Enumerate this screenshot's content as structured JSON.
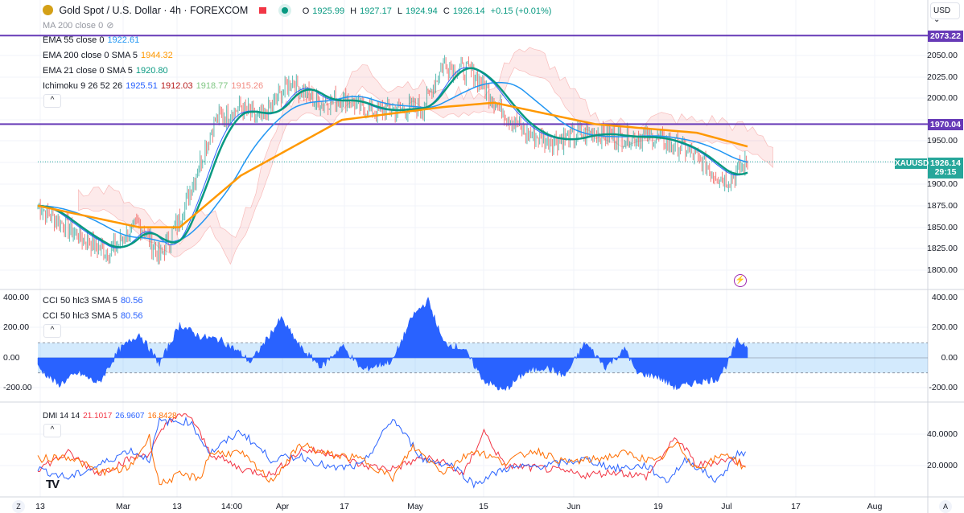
{
  "header": {
    "symbol": "Gold Spot / U.S. Dollar · 4h · FOREXCOM",
    "open_label": "O",
    "open": "1925.99",
    "high_label": "H",
    "high": "1927.17",
    "low_label": "L",
    "low": "1924.94",
    "close_label": "C",
    "close": "1926.14",
    "change": "+0.15 (+0.01%)"
  },
  "indicators": {
    "ma": "MA 200 close 0",
    "ema55": {
      "label": "EMA 55 close 0",
      "value": "1922.61"
    },
    "ema200": {
      "label": "EMA 200 close 0 SMA 5",
      "value": "1944.32"
    },
    "ema21": {
      "label": "EMA 21 close 0 SMA 5",
      "value": "1920.80"
    },
    "ichimoku": {
      "label": "Ichimoku 9 26 52 26",
      "v1": "1925.51",
      "v2": "1912.03",
      "v3": "1918.77",
      "v4": "1915.26"
    },
    "cci1": {
      "label": "CCI 50 hlc3 SMA 5",
      "value": "80.56"
    },
    "cci2": {
      "label": "CCI 50 hlc3 SMA 5",
      "value": "80.56"
    },
    "dmi": {
      "label": "DMI 14 14",
      "v1": "21.1017",
      "v2": "26.9607",
      "v3": "16.8428"
    }
  },
  "currency": "USD",
  "collapse_label": "^",
  "price_axis": [
    "2050.00",
    "2025.00",
    "2000.00",
    "1950.00",
    "1900.00",
    "1875.00",
    "1850.00",
    "1825.00",
    "1800.00"
  ],
  "hlines": {
    "upper": "2073.22",
    "lower": "1970.04"
  },
  "last_price": {
    "symbol": "XAUUSD",
    "price": "1926.14",
    "countdown": "29:15"
  },
  "cci_axis": [
    "400.00",
    "200.00",
    "0.00",
    "-200.00"
  ],
  "dmi_axis": [
    "40.0000",
    "20.0000"
  ],
  "time_axis": [
    "13",
    "Mar",
    "13",
    "14:00",
    "Apr",
    "17",
    "May",
    "15",
    "Jun",
    "19",
    "Jul",
    "17",
    "Aug"
  ],
  "corner": {
    "left": "Z",
    "right": "A"
  },
  "colors": {
    "up": "#26a69a",
    "down": "#ef5350",
    "ema55": "#2196f3",
    "ema200": "#ff9800",
    "ema21": "#089981",
    "hline": "#673ab7",
    "cci": "#2962ff",
    "dmi_plus": "#f23645",
    "dmi_minus": "#2962ff",
    "adx": "#ff6d00"
  },
  "chart_data": {
    "type": "line",
    "title": "Gold Spot / U.S. Dollar · 4h",
    "x_unit": "days since Feb 13",
    "close": [
      [
        0,
        1875
      ],
      [
        8,
        1840
      ],
      [
        14,
        1820
      ],
      [
        20,
        1855
      ],
      [
        24,
        1815
      ],
      [
        28,
        1860
      ],
      [
        31,
        1910
      ],
      [
        35,
        1975
      ],
      [
        40,
        1990
      ],
      [
        44,
        1975
      ],
      [
        50,
        2020
      ],
      [
        55,
        1995
      ],
      [
        60,
        2000
      ],
      [
        66,
        1985
      ],
      [
        76,
        1990
      ],
      [
        80,
        2040
      ],
      [
        86,
        2030
      ],
      [
        91,
        1990
      ],
      [
        96,
        1960
      ],
      [
        102,
        1950
      ],
      [
        109,
        1960
      ],
      [
        115,
        1955
      ],
      [
        121,
        1955
      ],
      [
        128,
        1940
      ],
      [
        133,
        1915
      ],
      [
        136,
        1905
      ],
      [
        140,
        1926
      ]
    ],
    "ema200": [
      [
        0,
        1875
      ],
      [
        20,
        1850
      ],
      [
        28,
        1850
      ],
      [
        40,
        1910
      ],
      [
        60,
        1975
      ],
      [
        80,
        1990
      ],
      [
        90,
        1995
      ],
      [
        110,
        1970
      ],
      [
        130,
        1960
      ],
      [
        140,
        1944
      ]
    ],
    "cci": [
      [
        0,
        -60
      ],
      [
        4,
        -180
      ],
      [
        8,
        -100
      ],
      [
        12,
        -170
      ],
      [
        16,
        50
      ],
      [
        20,
        160
      ],
      [
        24,
        -40
      ],
      [
        28,
        220
      ],
      [
        32,
        140
      ],
      [
        36,
        120
      ],
      [
        40,
        30
      ],
      [
        42,
        -30
      ],
      [
        48,
        260
      ],
      [
        52,
        60
      ],
      [
        56,
        -60
      ],
      [
        60,
        80
      ],
      [
        64,
        -80
      ],
      [
        70,
        -20
      ],
      [
        74,
        280
      ],
      [
        77,
        380
      ],
      [
        80,
        100
      ],
      [
        84,
        60
      ],
      [
        88,
        -150
      ],
      [
        92,
        -220
      ],
      [
        96,
        -100
      ],
      [
        100,
        -60
      ],
      [
        104,
        -120
      ],
      [
        108,
        100
      ],
      [
        112,
        -60
      ],
      [
        116,
        60
      ],
      [
        118,
        -100
      ],
      [
        122,
        -120
      ],
      [
        126,
        -200
      ],
      [
        130,
        -160
      ],
      [
        134,
        -140
      ],
      [
        136,
        -40
      ],
      [
        138,
        110
      ],
      [
        140,
        80
      ]
    ],
    "dmi_plus": [
      [
        0,
        18
      ],
      [
        6,
        28
      ],
      [
        12,
        15
      ],
      [
        18,
        24
      ],
      [
        22,
        28
      ],
      [
        26,
        50
      ],
      [
        30,
        52
      ],
      [
        34,
        28
      ],
      [
        40,
        18
      ],
      [
        46,
        14
      ],
      [
        52,
        30
      ],
      [
        58,
        28
      ],
      [
        64,
        20
      ],
      [
        70,
        18
      ],
      [
        76,
        25
      ],
      [
        80,
        22
      ],
      [
        84,
        14
      ],
      [
        88,
        42
      ],
      [
        92,
        20
      ],
      [
        100,
        18
      ],
      [
        108,
        14
      ],
      [
        114,
        16
      ],
      [
        120,
        13
      ],
      [
        126,
        38
      ],
      [
        130,
        20
      ],
      [
        136,
        24
      ],
      [
        140,
        21
      ]
    ],
    "dmi_minus": [
      [
        0,
        18
      ],
      [
        6,
        12
      ],
      [
        12,
        20
      ],
      [
        18,
        30
      ],
      [
        22,
        24
      ],
      [
        24,
        48
      ],
      [
        30,
        48
      ],
      [
        34,
        28
      ],
      [
        40,
        42
      ],
      [
        46,
        24
      ],
      [
        52,
        26
      ],
      [
        58,
        18
      ],
      [
        64,
        20
      ],
      [
        70,
        50
      ],
      [
        76,
        24
      ],
      [
        82,
        20
      ],
      [
        86,
        8
      ],
      [
        92,
        18
      ],
      [
        100,
        20
      ],
      [
        108,
        24
      ],
      [
        114,
        18
      ],
      [
        120,
        20
      ],
      [
        124,
        10
      ],
      [
        128,
        24
      ],
      [
        134,
        10
      ],
      [
        138,
        28
      ],
      [
        140,
        27
      ]
    ],
    "adx": [
      [
        0,
        24
      ],
      [
        6,
        26
      ],
      [
        12,
        16
      ],
      [
        18,
        18
      ],
      [
        22,
        38
      ],
      [
        24,
        8
      ],
      [
        28,
        14
      ],
      [
        32,
        12
      ],
      [
        34,
        28
      ],
      [
        40,
        28
      ],
      [
        46,
        10
      ],
      [
        52,
        34
      ],
      [
        56,
        28
      ],
      [
        64,
        24
      ],
      [
        70,
        12
      ],
      [
        74,
        32
      ],
      [
        80,
        16
      ],
      [
        86,
        30
      ],
      [
        92,
        22
      ],
      [
        98,
        30
      ],
      [
        104,
        22
      ],
      [
        110,
        24
      ],
      [
        116,
        28
      ],
      [
        122,
        22
      ],
      [
        126,
        34
      ],
      [
        130,
        18
      ],
      [
        136,
        28
      ],
      [
        140,
        17
      ]
    ],
    "price_ylim": [
      1790,
      2085
    ],
    "cci_ylim": [
      -300,
      420
    ],
    "dmi_ylim": [
      0,
      60
    ]
  }
}
